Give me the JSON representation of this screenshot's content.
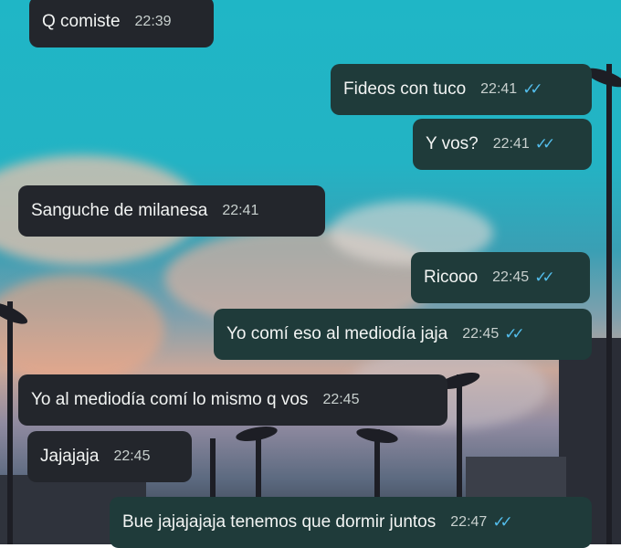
{
  "colors": {
    "outgoing_bubble": "#1f3b3a",
    "incoming_bubble": "#23262c",
    "read_ticks": "#53bdeb",
    "sky": "#1fb6c6"
  },
  "messages": [
    {
      "direction": "in",
      "text": "Q comiste",
      "time": "22:39"
    },
    {
      "direction": "out",
      "text": "Fideos con tuco",
      "time": "22:41",
      "ticks": "✓✓"
    },
    {
      "direction": "out",
      "text": "Y vos?",
      "time": "22:41",
      "ticks": "✓✓"
    },
    {
      "direction": "in",
      "text": "Sanguche de milanesa",
      "time": "22:41"
    },
    {
      "direction": "out",
      "text": "Ricooo",
      "time": "22:45",
      "ticks": "✓✓"
    },
    {
      "direction": "out",
      "text": "Yo comí eso al mediodía jaja",
      "time": "22:45",
      "ticks": "✓✓"
    },
    {
      "direction": "in",
      "text": "Yo al mediodía comí lo mismo q vos",
      "time": "22:45"
    },
    {
      "direction": "in",
      "text": "Jajajaja",
      "time": "22:45"
    },
    {
      "direction": "out",
      "text": "Bue jajajajaja tenemos que dormir juntos",
      "time": "22:47",
      "ticks": "✓✓"
    }
  ]
}
